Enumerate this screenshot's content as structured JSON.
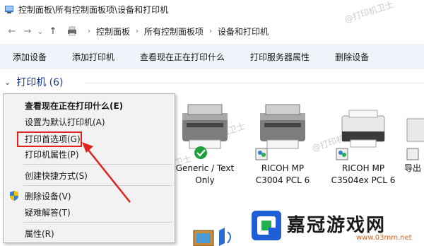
{
  "window": {
    "title": "控制面板\\所有控制面板项\\设备和打印机"
  },
  "watermark": "@打印机卫士",
  "nav": {
    "back": "←",
    "forward": "→",
    "dropdown": "⌄",
    "up": "↑"
  },
  "breadcrumb": [
    "控制面板",
    "所有控制面板项",
    "设备和打印机"
  ],
  "toolbar": {
    "commands": [
      "添加设备",
      "添加打印机",
      "查看现在正在打印什么",
      "打印服务器属性",
      "删除设备"
    ]
  },
  "group": {
    "label": "打印机 (6)"
  },
  "devices": [
    {
      "line1": "Generic / Text",
      "line2": "Only",
      "icon": "printer-icon",
      "default": true
    },
    {
      "line1": "RICOH MP",
      "line2": "C3004 PCL 6",
      "icon": "printer-icon",
      "default": false
    },
    {
      "line1": "RICOH MP",
      "line2": "C3504ex PCL 6",
      "icon": "printer-icon",
      "default": false
    },
    {
      "line1": "导出",
      "line2": "",
      "icon": "printer-icon",
      "default": false
    }
  ],
  "context_menu": {
    "items": [
      {
        "label": "查看现在正在打印什么(E)",
        "bold": true
      },
      {
        "label": "设置为默认打印机(A)"
      },
      {
        "label": "打印首选项(G)",
        "highlighted": true
      },
      {
        "label": "打印机属性(P)"
      },
      {
        "label": "创建快捷方式(S)"
      },
      {
        "label": "删除设备(V)",
        "icon": "shield-icon"
      },
      {
        "label": "疑难解答(T)"
      },
      {
        "label": "属性(R)"
      }
    ]
  },
  "logo": {
    "name": "嘉冠游戏网",
    "url": "www.03mm.net"
  },
  "colors": {
    "accent": "#e0231c",
    "cmdbar": "#eef4fa",
    "group_title": "#1e3a8a",
    "logo_green": "#22b14c",
    "logo_blue": "#1f5fd6"
  }
}
